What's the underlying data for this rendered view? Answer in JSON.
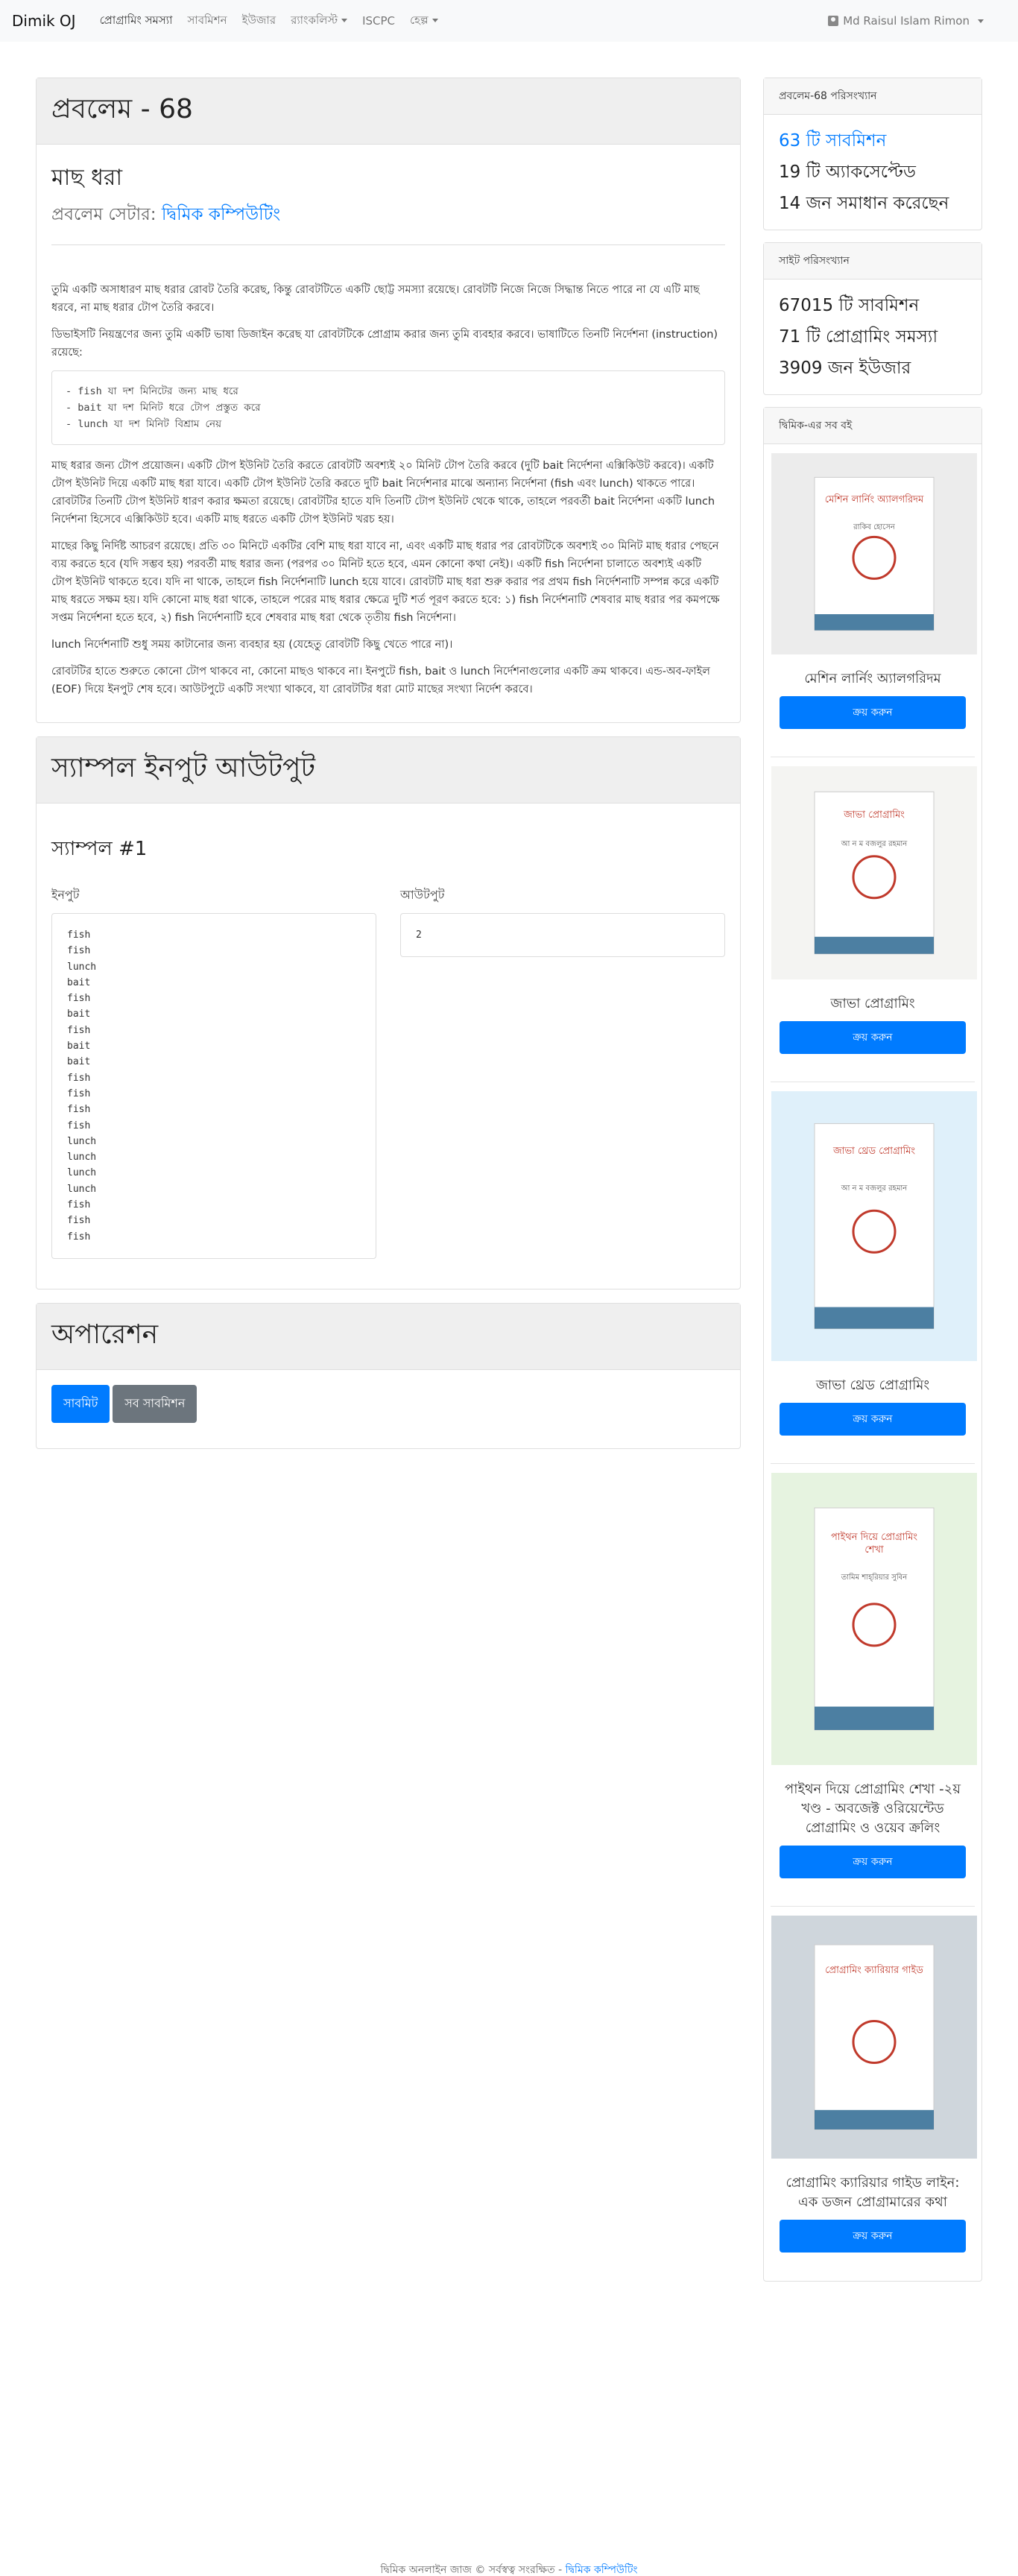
{
  "nav": {
    "brand": "Dimik OJ",
    "items": [
      "প্রোগ্রামিং সমস্যা",
      "সাবমিশন",
      "ইউজার",
      "র‍্যাংকলিস্ট",
      "ISCPC",
      "হেল্প"
    ],
    "user": "Md Raisul Islam Rimon"
  },
  "problem": {
    "header": "প্রবলেম - 68",
    "title": "মাছ ধরা",
    "setter_label": "প্রবলেম সেটার:",
    "setter_name": "দ্বিমিক কম্পিউটিং",
    "para1": "তুমি একটি অসাধারণ মাছ ধরার রোবট তৈরি করেছ, কিন্তু রোবটটিতে একটি ছোট্ট সমস্যা রয়েছে। রোবটটি নিজে নিজে সিদ্ধান্ত নিতে পারে না যে এটি মাছ ধরবে, না মাছ ধরার টোপ তৈরি করবে।",
    "para2": "ডিভাইসটি নিয়ন্ত্রণের জন্য তুমি একটি ভাষা ডিজাইন করেছ যা রোবটটিকে প্রোগ্রাম করার জন্য তুমি ব্যবহার করবে। ভাষাটিতে তিনটি নির্দেশনা (instruction) রয়েছে:",
    "code_lines": [
      "- fish যা দশ মিনিটের জন্য মাছ ধরে",
      "- bait যা দশ মিনিট ধরে টোপ প্রস্তুত করে",
      "- lunch যা দশ মিনিট বিশ্রাম নেয়"
    ],
    "para3": "মাছ ধরার জন্য টোপ প্রয়োজন। একটি টোপ ইউনিট তৈরি করতে রোবটটি অবশ্যই ২০ মিনিট টোপ তৈরি করবে (দুটি bait নির্দেশনা এক্সিকিউট করবে)। একটি টোপ ইউনিট দিয়ে একটি মাছ ধরা যাবে। একটি টোপ ইউনিট তৈরি করতে দুটি bait নির্দেশনার মাঝে অন্যান্য নির্দেশনা (fish এবং lunch) থাকতে পারে। রোবটটির তিনটি টোপ ইউনিট ধারণ করার ক্ষমতা রয়েছে। রোবটটির হাতে যদি তিনটি টোপ ইউনিট থেকে থাকে, তাহলে পরবর্তী bait নির্দেশনা একটি lunch নির্দেশনা হিসেবে এক্সিকিউট হবে। একটি মাছ ধরতে একটি টোপ ইউনিট খরচ হয়।",
    "para4": "মাছের কিছু নির্দিষ্ট আচরণ রয়েছে। প্রতি ৩০ মিনিটে একটির বেশি মাছ ধরা যাবে না, এবং একটি মাছ ধরার পর রোবটটিকে অবশ্যই ৩০ মিনিট মাছ ধরার পেছনে ব্যয় করতে হবে (যদি সম্ভব হয়) পরবর্তী মাছ ধরার জন্য (পরপর ৩০ মিনিট হতে হবে, এমন কোনো কথা নেই)। একটি fish নির্দেশনা চালাতে অবশ্যই একটি টোপ ইউনিট থাকতে হবে। যদি না থাকে, তাহলে fish নির্দেশনাটি lunch হয়ে যাবে। রোবটটি মাছ ধরা শুরু করার পর প্রথম fish নির্দেশনাটি সম্পন্ন করে একটি মাছ ধরতে সক্ষম হয়। যদি কোনো মাছ ধরা থাকে, তাহলে পরের মাছ ধরার ক্ষেত্রে দুটি শর্ত পূরণ করতে হবে: ১) fish নির্দেশনাটি শেষবার মাছ ধরার পর কমপক্ষে সপ্তম নির্দেশনা হতে হবে, ২) fish নির্দেশনাটি হবে শেষবার মাছ ধরা থেকে তৃতীয় fish নির্দেশনা।",
    "para5": "lunch নির্দেশনাটি শুধু সময় কাটানোর জন্য ব্যবহার হয় (যেহেতু রোবটটি কিছু খেতে পারে না)।",
    "para6": "রোবটটির হাতে শুরুতে কোনো টোপ থাকবে না, কোনো মাছও থাকবে না। ইনপুটে fish, bait ও lunch নির্দেশনাগুলোর একটি ক্রম থাকবে। এন্ড-অব-ফাইল (EOF) দিয়ে ইনপুট শেষ হবে। আউটপুটে একটি সংখ্যা থাকবে, যা রোবটটির ধরা মোট মাছের সংখ্যা নির্দেশ করবে।"
  },
  "samples": {
    "header": "স্যাম্পল ইনপুট আউটপুট",
    "title": "স্যাম্পল #1",
    "input_label": "ইনপুট",
    "output_label": "আউটপুট",
    "input_lines": [
      "fish",
      "fish",
      "lunch",
      "bait",
      "fish",
      "bait",
      "fish",
      "bait",
      "bait",
      "fish",
      "fish",
      "fish",
      "fish",
      "lunch",
      "lunch",
      "lunch",
      "lunch",
      "fish",
      "fish",
      "fish"
    ],
    "output": "2"
  },
  "operations": {
    "header": "অপারেশন",
    "submit": "সাবমিট",
    "all_submissions": "সব সাবমিশন"
  },
  "problem_stats": {
    "header": "প্রবলেম-68 পরিসংখ্যান",
    "submissions": "63 টি সাবমিশন",
    "accepted": "19 টি অ্যাকসেপ্টেড",
    "solved_by": "14 জন সমাধান করেছেন"
  },
  "site_stats": {
    "header": "সাইট পরিসংখ্যান",
    "submissions": "67015 টি সাবমিশন",
    "problems": "71 টি প্রোগ্রামিং সমস্যা",
    "users": "3909 জন ইউজার"
  },
  "books": {
    "header": "দ্বিমিক-এর সব বই",
    "buy_label": "ক্রয় করুন",
    "items": [
      {
        "name": "মেশিন লার্নিং অ্যালগরিদম",
        "cover_title": "মেশিন লার্নিং অ্যালগরিদম",
        "cover_author": "রাকিব হোসেন",
        "bg": "#ececec"
      },
      {
        "name": "জাভা প্রোগ্রামিং",
        "cover_title": "জাভা প্রোগ্রামিং",
        "cover_author": "আ ন ম বজলুর রহমান",
        "bg": "#f4f4f2"
      },
      {
        "name": "জাভা থ্রেড প্রোগ্রামিং",
        "cover_title": "জাভা থ্রেড প্রোগ্রামিং",
        "cover_author": "আ ন ম বজলুর রহমান",
        "bg": "#dff0fa"
      },
      {
        "name": "পাইথন দিয়ে প্রোগ্রামিং শেখা -২য় খণ্ড - অবজেক্ট ওরিয়েন্টেড প্রোগ্রামিং ও ওয়েব ক্রলিং",
        "cover_title": "পাইথন দিয়ে প্রোগ্রামিং শেখা",
        "cover_author": "তামিম শাহ্‌রিয়ার সুবিন",
        "bg": "#e6f3e0"
      },
      {
        "name": "প্রোগ্রামিং ক্যারিয়ার গাইড লাইন: এক ডজন প্রোগ্রামারের কথা",
        "cover_title": "প্রোগ্রামিং ক্যারিয়ার গাইড",
        "cover_author": "",
        "bg": "#cfd6dc"
      }
    ]
  },
  "footer": {
    "text": "দ্বিমিক অনলাইন জাজ © সর্বস্বত্ব সংরক্ষিত -",
    "link": "দ্বিমিক কম্পিউটিং"
  }
}
